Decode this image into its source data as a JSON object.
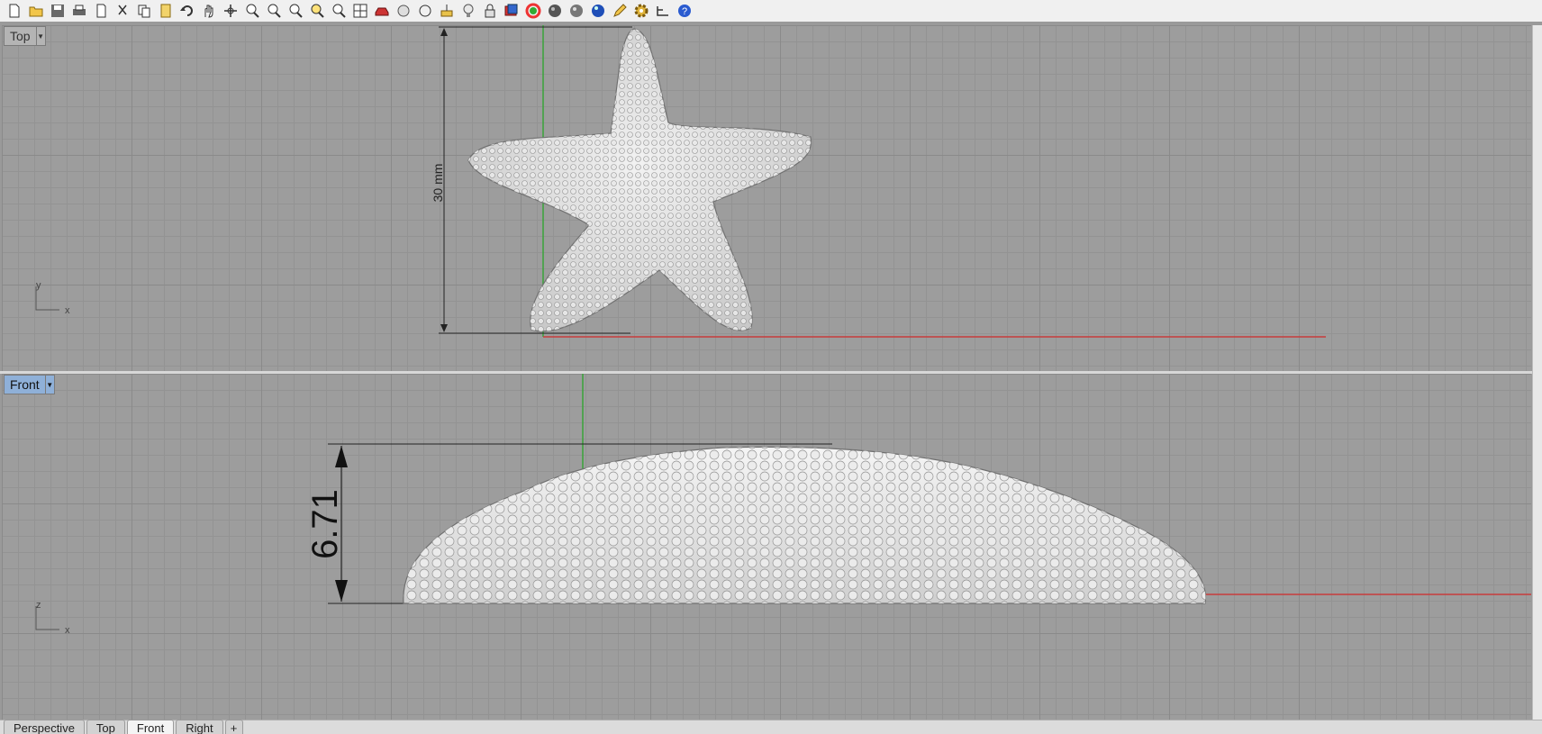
{
  "toolbar": {
    "icons": [
      "new-icon",
      "open-icon",
      "save-icon",
      "print-icon",
      "import-icon",
      "cut-icon",
      "copy-icon",
      "paste-icon",
      "undo-icon",
      "pan-icon",
      "rotate-icon",
      "zoom-icon",
      "zoom-window-icon",
      "zoom-dynamic-icon",
      "zoom-selected-icon",
      "zoom-extents-icon",
      "grid-icon",
      "car-icon",
      "render-settings-icon",
      "circle-icon",
      "layers-icon",
      "light-icon",
      "lock-icon",
      "material-icon",
      "color-wheel-icon",
      "sphere-icon",
      "shaded-sphere-icon",
      "render-sphere-icon",
      "pencil-icon",
      "gear-icon",
      "dimension-icon",
      "help-icon"
    ]
  },
  "viewports": {
    "top": {
      "label": "Top",
      "dimension_text": "30 mm",
      "axis_y": "y",
      "axis_x": "x"
    },
    "front": {
      "label": "Front",
      "dimension_text": "6.71",
      "axis_z": "z",
      "axis_x": "x"
    }
  },
  "tabs": [
    {
      "label": "Perspective",
      "active": false
    },
    {
      "label": "Top",
      "active": false
    },
    {
      "label": "Front",
      "active": true
    },
    {
      "label": "Right",
      "active": false
    }
  ],
  "tab_add_label": "+",
  "colors": {
    "x_axis": "#c83c3c",
    "y_axis": "#3aa33a",
    "viewport_bg": "#9d9d9d",
    "active_label": "#8fb0d8"
  }
}
